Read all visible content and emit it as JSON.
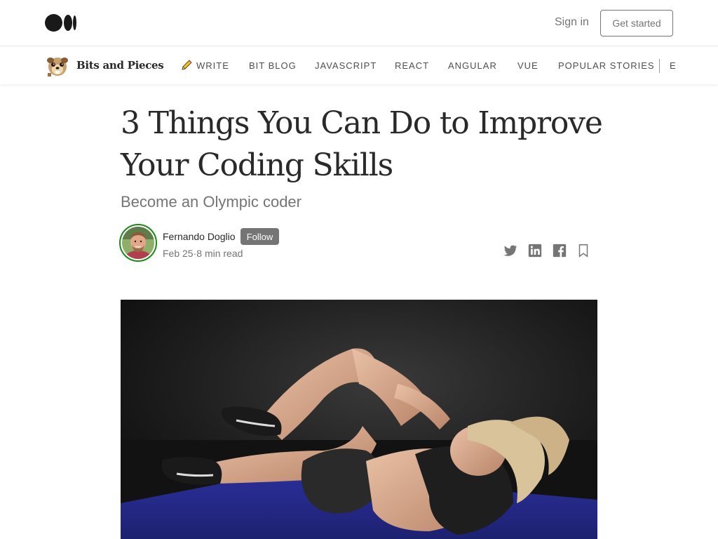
{
  "header": {
    "logo_icon": "medium-logo-icon",
    "signin_label": "Sign in",
    "get_started_label": "Get started"
  },
  "publication": {
    "logo_icon": "meerkat-logo-icon",
    "name": "Bits and Pieces",
    "nav": [
      {
        "label": "Write",
        "icon": "pencil-icon"
      },
      {
        "label": "Bit Blog"
      },
      {
        "label": "JavaScript"
      },
      {
        "label": "React"
      },
      {
        "label": "Angular"
      },
      {
        "label": "Vue"
      },
      {
        "label": "Popular Stories"
      },
      {
        "label": "E"
      }
    ]
  },
  "article": {
    "title": "3 Things You Can Do to Improve Your Coding Skills",
    "subtitle": "Become an Olympic coder",
    "author": {
      "name": "Fernando Doglio",
      "follow_label": "Follow",
      "date": "Feb 25",
      "separator": "·",
      "read_time": "8 min read"
    },
    "share_icons": [
      "twitter-icon",
      "linkedin-icon",
      "facebook-icon",
      "bookmark-icon"
    ],
    "hero_image": "woman-doing-crunches-photo"
  },
  "colors": {
    "text_primary": "#292929",
    "text_secondary": "#757575",
    "follow_bg": "#757575",
    "avatar_ring": "#1a8917",
    "mat_blue": "#2a2f8f"
  }
}
